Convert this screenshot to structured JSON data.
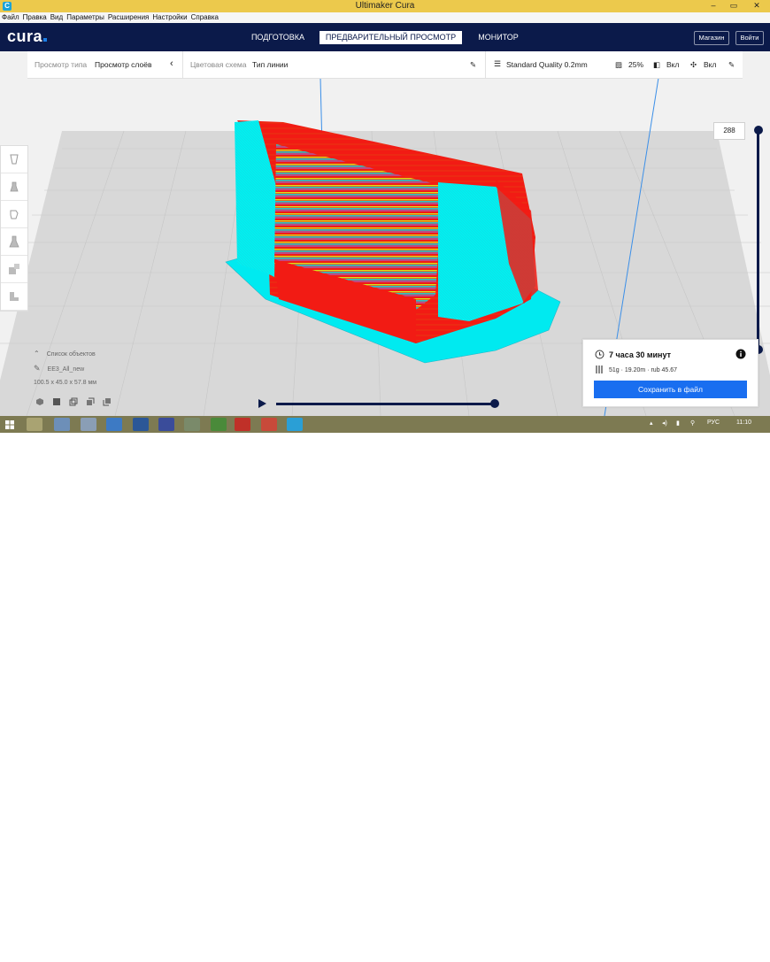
{
  "window": {
    "title": "Ultimaker Cura",
    "controls": [
      "–",
      "▭",
      "✕"
    ]
  },
  "menu": [
    "Файл",
    "Правка",
    "Вид",
    "Параметры",
    "Расширения",
    "Настройки",
    "Справка"
  ],
  "header": {
    "logo": "cura",
    "stages": [
      "ПОДГОТОВКА",
      "ПРЕДВАРИТЕЛЬНЫЙ ПРОСМОТР",
      "МОНИТОР"
    ],
    "active_stage": "ПРЕДВАРИТЕЛЬНЫЙ ПРОСМОТР",
    "marketplace": "Магазин",
    "sign_in": "Войти"
  },
  "toolbar": {
    "view_type_label": "Просмотр типа",
    "view_type_value": "Просмотр слоёв",
    "color_scheme_label": "Цветовая схема",
    "color_scheme_value": "Тип линии",
    "quality": "Standard Quality 0.2mm",
    "infill": "25%",
    "support": "Вкл",
    "adhesion": "Вкл"
  },
  "left_tools": [
    "move-tool-icon",
    "scale-tool-icon",
    "rotate-tool-icon",
    "mirror-tool-icon",
    "per-model-settings-icon",
    "support-blocker-icon"
  ],
  "object_list": {
    "header": "Список объектов",
    "name": "EE3_All_new",
    "dimensions": "100.5 x 45.0 x 57.8 мм"
  },
  "layer_slider": {
    "current_layer": "288"
  },
  "print_info": {
    "time": "7 часа 30 минут",
    "material": "51g · 19.20m · rub 45.67",
    "save_button": "Сохранить в файл"
  },
  "taskbar": {
    "language": "РУС",
    "clock": "11:10"
  },
  "colors": {
    "header": "#0b1a4a",
    "accent": "#196ef0",
    "model_red": "#f21b14",
    "model_cyan": "#00f4f4",
    "titlebar": "#ecc94c",
    "taskbar": "#7d7a52"
  }
}
